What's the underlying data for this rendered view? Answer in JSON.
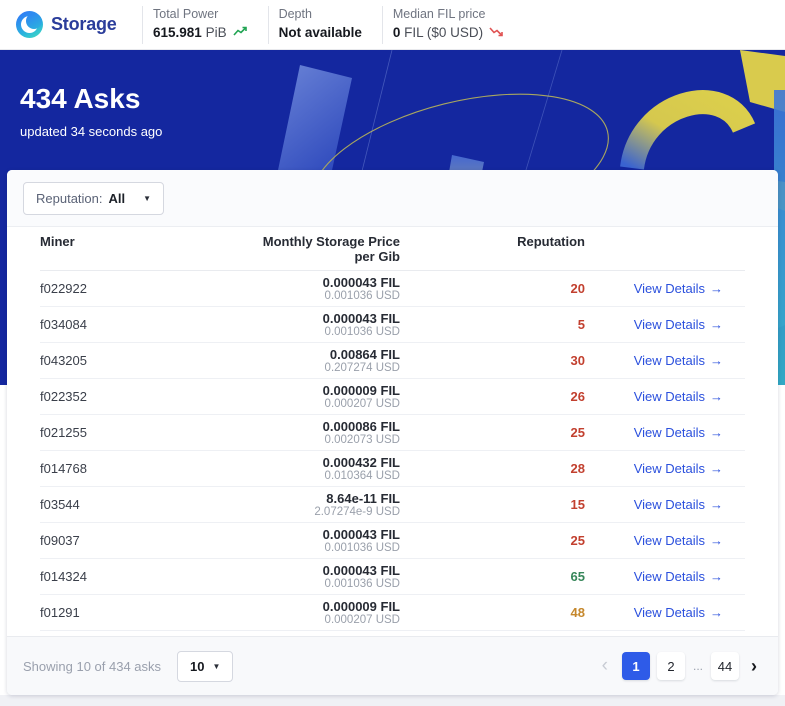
{
  "header": {
    "logo_text": "Storage",
    "stats": [
      {
        "label": "Total Power",
        "value": "615.981",
        "unit": " PiB",
        "trend": "up"
      },
      {
        "label": "Depth",
        "value": "Not available",
        "unit": "",
        "trend": "none"
      },
      {
        "label": "Median FIL price",
        "value": "0",
        "unit": " FIL ($0 USD)",
        "trend": "down"
      }
    ]
  },
  "hero": {
    "title": "434 Asks",
    "updated": "updated 34 seconds ago"
  },
  "filter": {
    "label": "Reputation:",
    "value": "All"
  },
  "table": {
    "headers": {
      "miner": "Miner",
      "price_line1": "Monthly Storage Price",
      "price_line2": "per Gib",
      "reputation": "Reputation"
    },
    "view_details_label": "View Details",
    "rows": [
      {
        "miner": "f022922",
        "fil": "0.000043 FIL",
        "usd": "0.001036 USD",
        "reputation": "20",
        "rep_class": "rep-red"
      },
      {
        "miner": "f034084",
        "fil": "0.000043 FIL",
        "usd": "0.001036 USD",
        "reputation": "5",
        "rep_class": "rep-red"
      },
      {
        "miner": "f043205",
        "fil": "0.00864 FIL",
        "usd": "0.207274 USD",
        "reputation": "30",
        "rep_class": "rep-red"
      },
      {
        "miner": "f022352",
        "fil": "0.000009 FIL",
        "usd": "0.000207 USD",
        "reputation": "26",
        "rep_class": "rep-red"
      },
      {
        "miner": "f021255",
        "fil": "0.000086 FIL",
        "usd": "0.002073 USD",
        "reputation": "25",
        "rep_class": "rep-red"
      },
      {
        "miner": "f014768",
        "fil": "0.000432 FIL",
        "usd": "0.010364 USD",
        "reputation": "28",
        "rep_class": "rep-red"
      },
      {
        "miner": "f03544",
        "fil": "8.64e-11 FIL",
        "usd": "2.07274e-9 USD",
        "reputation": "15",
        "rep_class": "rep-red"
      },
      {
        "miner": "f09037",
        "fil": "0.000043 FIL",
        "usd": "0.001036 USD",
        "reputation": "25",
        "rep_class": "rep-red"
      },
      {
        "miner": "f014324",
        "fil": "0.000043 FIL",
        "usd": "0.001036 USD",
        "reputation": "65",
        "rep_class": "rep-green"
      },
      {
        "miner": "f01291",
        "fil": "0.000009 FIL",
        "usd": "0.000207 USD",
        "reputation": "48",
        "rep_class": "rep-orange"
      }
    ]
  },
  "footer": {
    "summary": "Showing 10 of 434 asks",
    "page_size": "10",
    "pagination": {
      "pages": [
        "1",
        "2",
        "...",
        "44"
      ],
      "active": "1"
    }
  },
  "icons": {
    "arrow_right": "→",
    "caret_down": "▼",
    "prev": "‹",
    "next": "›"
  },
  "colors": {
    "hero_bg": "#14279f",
    "accent_blue": "#2b50dd",
    "active_page_bg": "#2e5be8",
    "rep_red": "#c2402f",
    "rep_green": "#37875a",
    "rep_orange": "#c5872b",
    "trend_up_green": "#21a453",
    "trend_down_red": "#e05252"
  }
}
